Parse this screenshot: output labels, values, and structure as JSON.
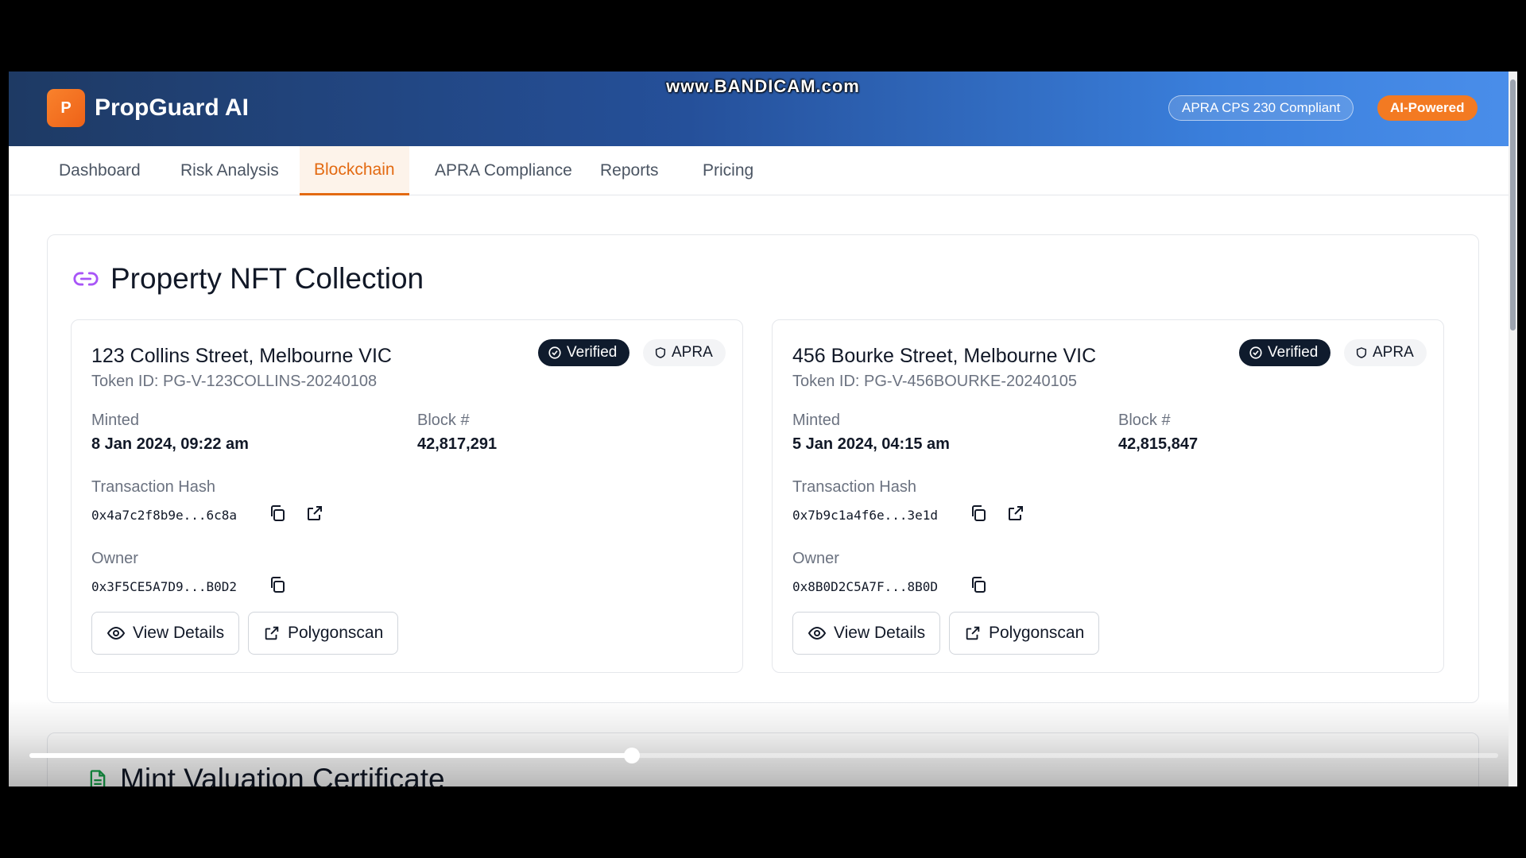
{
  "header": {
    "logo_letter": "P",
    "app_title": "PropGuard AI",
    "watermark": "www.BANDICAM.com",
    "compliance_badge": "APRA CPS 230 Compliant",
    "ai_badge": "AI-Powered"
  },
  "tabs": [
    {
      "label": "Dashboard",
      "active": false
    },
    {
      "label": "Risk Analysis",
      "active": false
    },
    {
      "label": "Blockchain",
      "active": true
    },
    {
      "label": "APRA Compliance",
      "active": false
    },
    {
      "label": "Reports",
      "active": false
    },
    {
      "label": "Pricing",
      "active": false
    }
  ],
  "section": {
    "title": "Property NFT Collection",
    "icon": "link-icon"
  },
  "labels": {
    "minted": "Minted",
    "block": "Block #",
    "tx_hash": "Transaction Hash",
    "owner": "Owner",
    "view_details": "View Details",
    "polygonscan": "Polygonscan",
    "verified": "Verified",
    "apra": "APRA"
  },
  "nfts": [
    {
      "name": "123 Collins Street, Melbourne VIC",
      "token": "Token ID: PG-V-123COLLINS-20240108",
      "minted": "8 Jan 2024, 09:22 am",
      "block": "42,817,291",
      "tx_hash": "0x4a7c2f8b9e...6c8a",
      "owner": "0x3F5CE5A7D9...B0D2"
    },
    {
      "name": "456 Bourke Street, Melbourne VIC",
      "token": "Token ID: PG-V-456BOURKE-20240105",
      "minted": "5 Jan 2024, 04:15 am",
      "block": "42,815,847",
      "tx_hash": "0x7b9c1a4f6e...3e1d",
      "owner": "0x8B0D2C5A7F...8B0D"
    }
  ],
  "next_section": {
    "title": "Mint Valuation Certificate",
    "icon": "document-icon"
  },
  "video": {
    "progress": 0.41
  },
  "colors": {
    "accent": "#e36a12",
    "header_start": "#1e3a64",
    "header_end": "#4a8eea",
    "verified_bg": "#0f1b2d"
  }
}
